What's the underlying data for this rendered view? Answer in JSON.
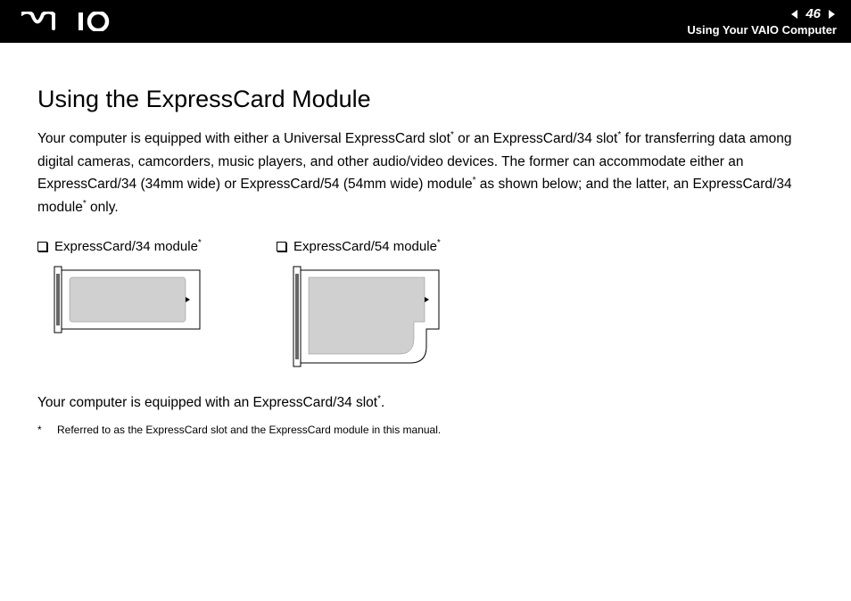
{
  "header": {
    "page_number": "46",
    "subtitle": "Using Your VAIO Computer"
  },
  "title": "Using the ExpressCard Module",
  "intro_parts": {
    "p1": "Your computer is equipped with either a Universal ExpressCard slot",
    "p2": " or an ExpressCard/34 slot",
    "p3": " for transferring data among digital cameras, camcorders, music players, and other audio/video devices. The former can accommodate either an ExpressCard/34 (34mm wide) or ExpressCard/54 (54mm wide) module",
    "p4": " as shown below; and the latter, an ExpressCard/34 module",
    "p5": " only."
  },
  "modules": {
    "m34": "ExpressCard/34 module",
    "m54": "ExpressCard/54 module"
  },
  "note_parts": {
    "n1": "Your computer is equipped with an ExpressCard/34 slot",
    "n2": "."
  },
  "footnote": {
    "star": "*",
    "text": "Referred to as the ExpressCard slot and the ExpressCard module in this manual."
  }
}
